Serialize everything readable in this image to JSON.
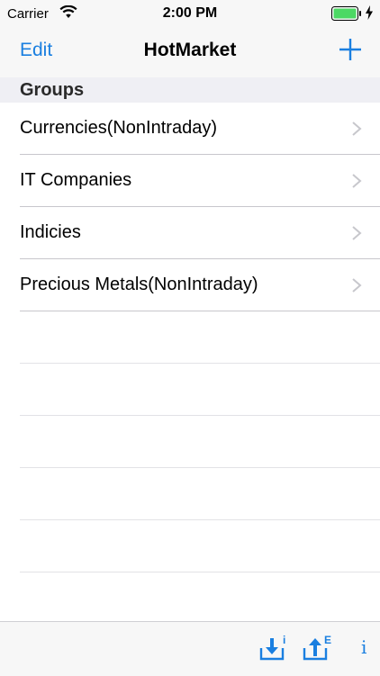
{
  "status_bar": {
    "carrier": "Carrier",
    "time": "2:00 PM",
    "battery_color": "#4cd964"
  },
  "nav": {
    "edit_label": "Edit",
    "title": "HotMarket",
    "add_icon": "plus-icon"
  },
  "section": {
    "header": "Groups"
  },
  "groups": [
    {
      "label": "Currencies(NonIntraday)"
    },
    {
      "label": "IT Companies"
    },
    {
      "label": "Indicies"
    },
    {
      "label": "Precious Metals(NonIntraday)"
    }
  ],
  "toolbar": {
    "import_icon": "download-import-icon",
    "import_badge": "i",
    "export_icon": "upload-export-icon",
    "export_badge": "E",
    "info_label": "i"
  },
  "colors": {
    "accent": "#1a7fe0",
    "bar_background": "#f7f7f7",
    "separator": "#c8c7cc"
  }
}
